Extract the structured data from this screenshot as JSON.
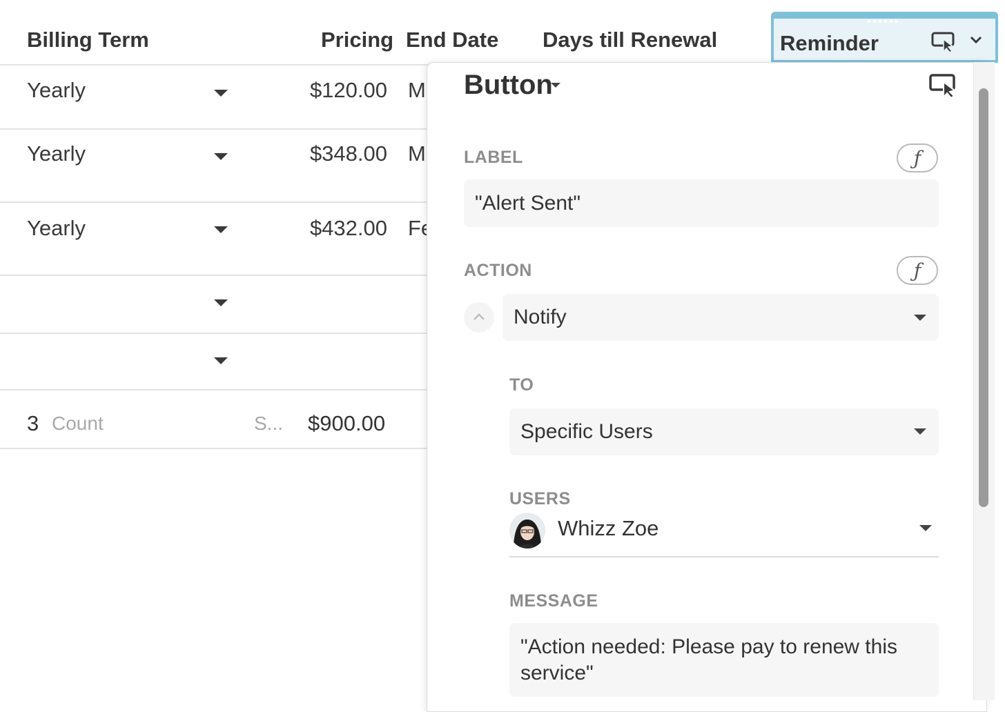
{
  "table": {
    "headers": {
      "billing_term": "Billing Term",
      "pricing": "Pricing",
      "end_date": "End Date",
      "days_till_renewal": "Days till Renewal",
      "reminder": "Reminder"
    },
    "rows": [
      {
        "billing_term": "Yearly",
        "pricing": "$120.00",
        "end_date_partial": "M"
      },
      {
        "billing_term": "Yearly",
        "pricing": "$348.00",
        "end_date_partial": "M"
      },
      {
        "billing_term": "Yearly",
        "pricing": "$432.00",
        "end_date_partial": "Fe"
      },
      {
        "billing_term": "",
        "pricing": "",
        "end_date_partial": ""
      },
      {
        "billing_term": "",
        "pricing": "",
        "end_date_partial": ""
      }
    ],
    "footer": {
      "count_value": "3",
      "count_label": "Count",
      "sum_label": "S...",
      "sum_value": "$900.00"
    }
  },
  "panel": {
    "title": "Button",
    "label": {
      "heading": "LABEL",
      "value": "\"Alert Sent\"",
      "formula_symbol": "ƒ"
    },
    "action": {
      "heading": "ACTION",
      "value": "Notify",
      "formula_symbol": "ƒ"
    },
    "to": {
      "heading": "TO",
      "value": "Specific Users"
    },
    "users": {
      "heading": "USERS",
      "name": "Whizz Zoe"
    },
    "message": {
      "heading": "MESSAGE",
      "value": "\"Action needed: Please pay to renew this service\""
    }
  },
  "icons": {
    "reminder_header_icon": "button-cursor-icon",
    "reminder_header_menu": "chevron-down-icon",
    "panel_icon": "button-cursor-icon",
    "collapse": "chevron-up-icon",
    "dropdown": "caret-down-icon"
  },
  "colors": {
    "accent_border": "#7ec0d9",
    "accent_fill": "#e8f3f8",
    "text": "#333333",
    "muted_label": "#8d8d8d"
  }
}
